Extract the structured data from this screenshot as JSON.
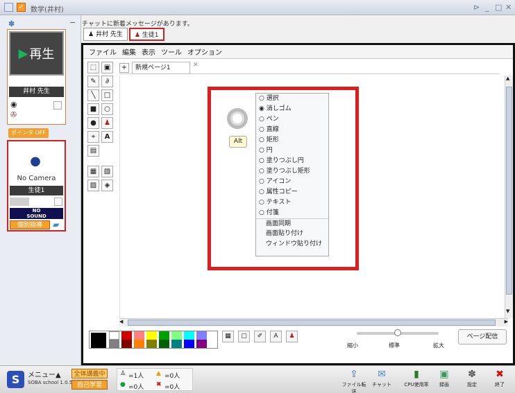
{
  "window": {
    "title": "数学(井村)",
    "controls": [
      "⊳",
      "_",
      "□",
      "✕"
    ]
  },
  "left": {
    "teacher_replay_label": "再生",
    "teacher_name": "井村 先生",
    "pointer_label": "ポインタ OFF",
    "camera_status": "No Camera",
    "student_name": "生徒1",
    "nosound_line1": "NO",
    "nosound_line2": "SOUND",
    "individual_label": "個別指導"
  },
  "message": "チャットに新着メッセージがあります。",
  "user_tabs": [
    {
      "label": "井村 先生",
      "active": false
    },
    {
      "label": "生徒1",
      "active": true
    }
  ],
  "menubar": [
    "ファイル",
    "編集",
    "表示",
    "ツール",
    "オプション"
  ],
  "page_tab": "新規ページ1",
  "alt_label": "Alt",
  "tool_menu": {
    "options": [
      {
        "label": "選択",
        "selected": false
      },
      {
        "label": "消しゴム",
        "selected": true
      },
      {
        "label": "ペン",
        "selected": false
      },
      {
        "label": "直線",
        "selected": false
      },
      {
        "label": "矩形",
        "selected": false
      },
      {
        "label": "円",
        "selected": false
      },
      {
        "label": "塗りつぶし円",
        "selected": false
      },
      {
        "label": "塗りつぶし矩形",
        "selected": false
      },
      {
        "label": "アイコン",
        "selected": false
      },
      {
        "label": "属性コピー",
        "selected": false
      },
      {
        "label": "テキスト",
        "selected": false
      },
      {
        "label": "付箋",
        "selected": false
      }
    ],
    "commands": [
      "画面同期",
      "画面貼り付け",
      "ウィンドウ貼り付け"
    ]
  },
  "zoom": {
    "min_label": "縮小",
    "mid_label": "標準",
    "max_label": "拡大",
    "level": 0.5
  },
  "send_page_label": "ページ配信",
  "palette_colors": [
    "#000000",
    "#ffffff",
    "#d00000",
    "#ff8080",
    "#ffff00",
    "#00a000",
    "#80ff80",
    "#00ffff",
    "#0000ff",
    "#8080ff",
    "#ff00ff",
    "#808080"
  ],
  "status": {
    "menu_label": "メニュー▲",
    "brand": "SOBA school 1.0.5",
    "lecture_label": "全体講義中",
    "self_study_label": "自己学習",
    "counts": {
      "a": "=1人",
      "b": "=0人",
      "c": "=0人",
      "d": "=0人"
    },
    "buttons": [
      "ファイル転送",
      "チャット",
      "CPU使用率",
      "録画",
      "設定",
      "終了"
    ]
  },
  "accent_red": "#e11c1c",
  "accent_orange": "#f5a02a"
}
